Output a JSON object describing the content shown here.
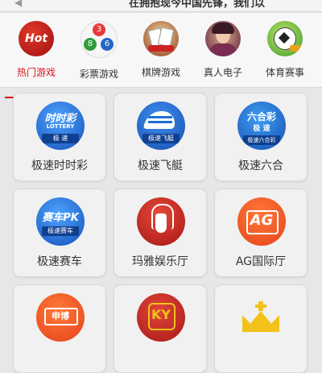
{
  "notice": {
    "text": "在拥抱现今中国先锋，我们以"
  },
  "tabs": [
    {
      "label": "热门游戏",
      "icon": "hot-icon",
      "active": true
    },
    {
      "label": "彩票游戏",
      "icon": "lottery-balls-icon",
      "active": false
    },
    {
      "label": "棋牌游戏",
      "icon": "cards-icon",
      "active": false
    },
    {
      "label": "真人电子",
      "icon": "live-dealer-icon",
      "active": false
    },
    {
      "label": "体育赛事",
      "icon": "soccer-ball-icon",
      "active": false
    }
  ],
  "tab_icon_text": {
    "hot": "Hot",
    "balls": [
      "3",
      "8",
      "6"
    ]
  },
  "games": [
    {
      "name": "极速时时彩",
      "logo_main": "时时彩",
      "logo_sub": "LOTTERY",
      "logo_badge": "极 速"
    },
    {
      "name": "极速飞艇",
      "logo_main": "",
      "logo_sub": "",
      "logo_badge": "极速飞艇"
    },
    {
      "name": "极速六合",
      "logo_main": "六合彩",
      "logo_sub": "极 速",
      "logo_badge": "极速六合彩"
    },
    {
      "name": "极速赛车",
      "logo_main": "赛车PK",
      "logo_sub": "",
      "logo_badge": "极速赛车"
    },
    {
      "name": "玛雅娱乐厅",
      "logo_main": "",
      "logo_sub": "",
      "logo_badge": ""
    },
    {
      "name": "AG国际厅",
      "logo_main": "AG",
      "logo_sub": "",
      "logo_badge": ""
    },
    {
      "name": "",
      "logo_main": "申博",
      "logo_sub": "",
      "logo_badge": ""
    },
    {
      "name": "",
      "logo_main": "KY",
      "logo_sub": "",
      "logo_badge": ""
    },
    {
      "name": "",
      "logo_main": "",
      "logo_sub": "",
      "logo_badge": ""
    }
  ],
  "colors": {
    "accent": "#d8151b",
    "text": "#333333",
    "blue_logo": "#1f6fd6",
    "red_logo": "#d62b2b",
    "orange_logo": "#f2501d",
    "gold": "#f2c21a"
  }
}
